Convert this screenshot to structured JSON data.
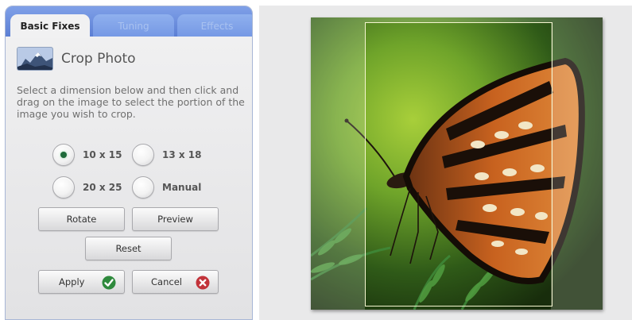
{
  "tabs": [
    {
      "label": "Basic Fixes",
      "active": true
    },
    {
      "label": "Tuning",
      "active": false
    },
    {
      "label": "Effects",
      "active": false
    }
  ],
  "panel": {
    "title": "Crop Photo",
    "instructions": "Select a dimension below and then click and drag on the image to select the portion of the image you wish to crop."
  },
  "dimensions": [
    {
      "label": "10 x 15",
      "selected": true
    },
    {
      "label": "13 x 18",
      "selected": false
    },
    {
      "label": "20 x 25",
      "selected": false
    },
    {
      "label": "Manual",
      "selected": false
    }
  ],
  "buttons": {
    "rotate": "Rotate",
    "preview": "Preview",
    "reset": "Reset",
    "apply": "Apply",
    "cancel": "Cancel"
  },
  "icons": {
    "crop_thumb": "mountain-photo-icon",
    "apply": "checkmark-icon",
    "cancel": "x-icon"
  },
  "colors": {
    "tab_strip": "#6b8fe0",
    "apply_icon": "#2f8a3d",
    "cancel_icon": "#c2333a",
    "radio_selected": "#1f6b3a"
  }
}
